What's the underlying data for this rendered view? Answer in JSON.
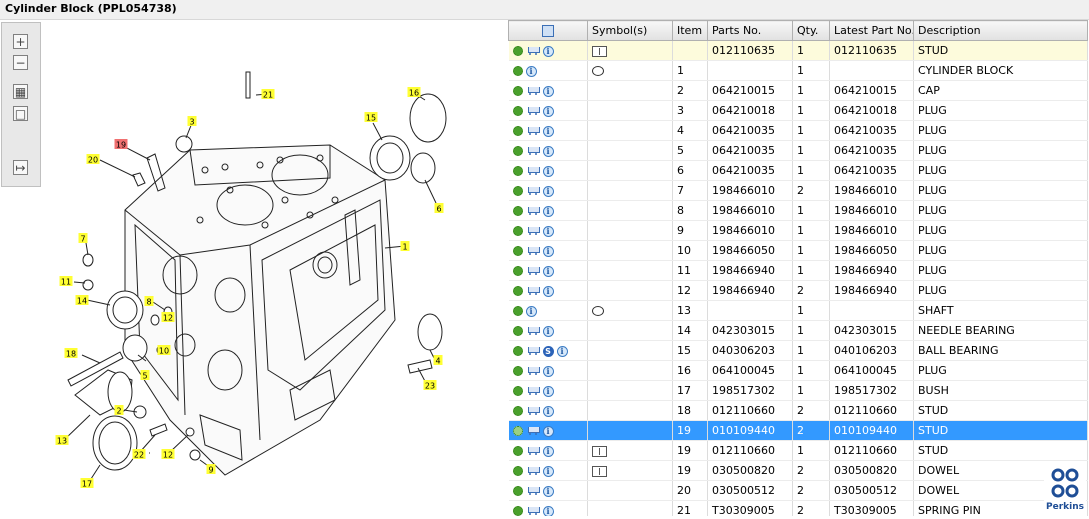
{
  "window": {
    "title": "Cylinder Block (PPL054738)"
  },
  "toolbar": {
    "icons": [
      "zoom-in-icon",
      "zoom-out-icon",
      "fit-page-icon",
      "actual-size-icon",
      "toggle-list-icon"
    ]
  },
  "diagram": {
    "callouts": [
      {
        "label": "21",
        "highlight": false
      },
      {
        "label": "16",
        "highlight": false
      },
      {
        "label": "3",
        "highlight": false
      },
      {
        "label": "15",
        "highlight": false
      },
      {
        "label": "19",
        "highlight": true
      },
      {
        "label": "20",
        "highlight": false
      },
      {
        "label": "6",
        "highlight": false
      },
      {
        "label": "7",
        "highlight": false
      },
      {
        "label": "1",
        "highlight": false
      },
      {
        "label": "11",
        "highlight": false
      },
      {
        "label": "14",
        "highlight": false
      },
      {
        "label": "8",
        "highlight": false
      },
      {
        "label": "12",
        "highlight": false
      },
      {
        "label": "4",
        "highlight": false
      },
      {
        "label": "18",
        "highlight": false
      },
      {
        "label": "10",
        "highlight": false
      },
      {
        "label": "5",
        "highlight": false
      },
      {
        "label": "23",
        "highlight": false
      },
      {
        "label": "2",
        "highlight": false
      },
      {
        "label": "13",
        "highlight": false
      },
      {
        "label": "22",
        "highlight": false
      },
      {
        "label": "12",
        "highlight": false
      },
      {
        "label": "9",
        "highlight": false
      },
      {
        "label": "17",
        "highlight": false
      }
    ]
  },
  "table": {
    "columns": [
      "",
      "Symbol(s)",
      "Item",
      "Parts No.",
      "Qty.",
      "Latest Part No.",
      "Description"
    ],
    "rows": [
      {
        "icons": "gear,cart,info",
        "symbol": "book",
        "item": "",
        "part": "012110635",
        "qty": "1",
        "latest": "012110635",
        "desc": "STUD",
        "state": "highlight"
      },
      {
        "icons": "gear,info",
        "symbol": "bubble",
        "item": "1",
        "part": "",
        "qty": "1",
        "latest": "",
        "desc": "CYLINDER BLOCK",
        "state": ""
      },
      {
        "icons": "gear,cart,info",
        "symbol": "",
        "item": "2",
        "part": "064210015",
        "qty": "1",
        "latest": "064210015",
        "desc": "CAP",
        "state": ""
      },
      {
        "icons": "gear,cart,info",
        "symbol": "",
        "item": "3",
        "part": "064210018",
        "qty": "1",
        "latest": "064210018",
        "desc": "PLUG",
        "state": ""
      },
      {
        "icons": "gear,cart,info",
        "symbol": "",
        "item": "4",
        "part": "064210035",
        "qty": "1",
        "latest": "064210035",
        "desc": "PLUG",
        "state": ""
      },
      {
        "icons": "gear,cart,info",
        "symbol": "",
        "item": "5",
        "part": "064210035",
        "qty": "1",
        "latest": "064210035",
        "desc": "PLUG",
        "state": ""
      },
      {
        "icons": "gear,cart,info",
        "symbol": "",
        "item": "6",
        "part": "064210035",
        "qty": "1",
        "latest": "064210035",
        "desc": "PLUG",
        "state": ""
      },
      {
        "icons": "gear,cart,info",
        "symbol": "",
        "item": "7",
        "part": "198466010",
        "qty": "2",
        "latest": "198466010",
        "desc": "PLUG",
        "state": ""
      },
      {
        "icons": "gear,cart,info",
        "symbol": "",
        "item": "8",
        "part": "198466010",
        "qty": "1",
        "latest": "198466010",
        "desc": "PLUG",
        "state": ""
      },
      {
        "icons": "gear,cart,info",
        "symbol": "",
        "item": "9",
        "part": "198466010",
        "qty": "1",
        "latest": "198466010",
        "desc": "PLUG",
        "state": ""
      },
      {
        "icons": "gear,cart,info",
        "symbol": "",
        "item": "10",
        "part": "198466050",
        "qty": "1",
        "latest": "198466050",
        "desc": "PLUG",
        "state": ""
      },
      {
        "icons": "gear,cart,info",
        "symbol": "",
        "item": "11",
        "part": "198466940",
        "qty": "1",
        "latest": "198466940",
        "desc": "PLUG",
        "state": ""
      },
      {
        "icons": "gear,cart,info",
        "symbol": "",
        "item": "12",
        "part": "198466940",
        "qty": "2",
        "latest": "198466940",
        "desc": "PLUG",
        "state": ""
      },
      {
        "icons": "gear,info",
        "symbol": "bubble",
        "item": "13",
        "part": "",
        "qty": "1",
        "latest": "",
        "desc": "SHAFT",
        "state": ""
      },
      {
        "icons": "gear,cart,info",
        "symbol": "",
        "item": "14",
        "part": "042303015",
        "qty": "1",
        "latest": "042303015",
        "desc": "NEEDLE BEARING",
        "state": ""
      },
      {
        "icons": "gear,cart,s,info",
        "symbol": "",
        "item": "15",
        "part": "040306203",
        "qty": "1",
        "latest": "040106203",
        "desc": "BALL BEARING",
        "state": ""
      },
      {
        "icons": "gear,cart,info",
        "symbol": "",
        "item": "16",
        "part": "064100045",
        "qty": "1",
        "latest": "064100045",
        "desc": "PLUG",
        "state": ""
      },
      {
        "icons": "gear,cart,info",
        "symbol": "",
        "item": "17",
        "part": "198517302",
        "qty": "1",
        "latest": "198517302",
        "desc": "BUSH",
        "state": ""
      },
      {
        "icons": "gear,cart,info",
        "symbol": "",
        "item": "18",
        "part": "012110660",
        "qty": "2",
        "latest": "012110660",
        "desc": "STUD",
        "state": ""
      },
      {
        "icons": "gear,cart,info",
        "symbol": "",
        "item": "19",
        "part": "010109440",
        "qty": "2",
        "latest": "010109440",
        "desc": "STUD",
        "state": "selected"
      },
      {
        "icons": "gear,cart,info",
        "symbol": "book",
        "item": "19",
        "part": "012110660",
        "qty": "1",
        "latest": "012110660",
        "desc": "STUD",
        "state": ""
      },
      {
        "icons": "gear,cart,info",
        "symbol": "book",
        "item": "19",
        "part": "030500820",
        "qty": "2",
        "latest": "030500820",
        "desc": "DOWEL",
        "state": ""
      },
      {
        "icons": "gear,cart,info",
        "symbol": "",
        "item": "20",
        "part": "030500512",
        "qty": "2",
        "latest": "030500512",
        "desc": "DOWEL",
        "state": ""
      },
      {
        "icons": "gear,cart,info",
        "symbol": "",
        "item": "21",
        "part": "T30309005",
        "qty": "2",
        "latest": "T30309005",
        "desc": "SPRING PIN",
        "state": ""
      }
    ]
  },
  "brand": {
    "name": "Perkins"
  }
}
